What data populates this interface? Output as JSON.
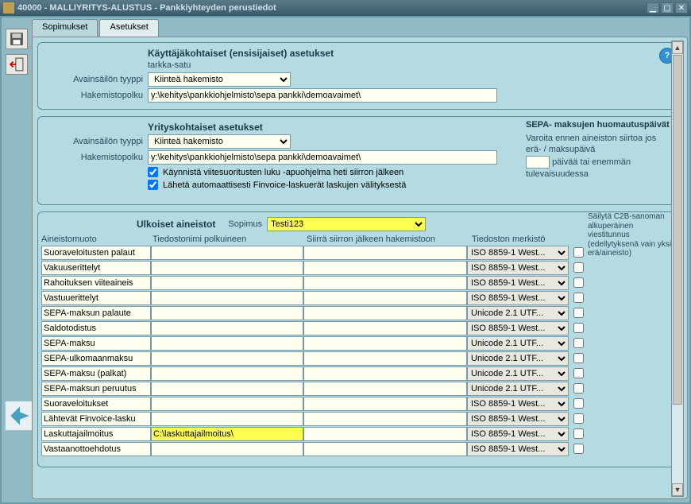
{
  "window": {
    "title": "40000 - MALLIYRITYS-ALUSTUS - Pankkiyhteyden perustiedot"
  },
  "tabs": {
    "t1": "Sopimukset",
    "t2": "Asetukset"
  },
  "panel1": {
    "title": "Käyttäjäkohtaiset (ensisijaiset) asetukset",
    "user": "tarkka-satu",
    "label_type": "Avainsäilön tyyppi",
    "type_value": "Kiinteä hakemisto",
    "label_path": "Hakemistopolku",
    "path_value": "y:\\kehitys\\pankkiohjelmisto\\sepa pankki\\demoavaimet\\"
  },
  "panel2": {
    "title": "Yrityskohtaiset asetukset",
    "label_type": "Avainsäilön tyyppi",
    "type_value": "Kiinteä hakemisto",
    "label_path": "Hakemistopolku",
    "path_value": "y:\\kehitys\\pankkiohjelmisto\\sepa pankki\\demoavaimet\\",
    "cb1": "Käynnistä viitesuoritusten luku -apuohjelma heti siirron jälkeen",
    "cb2": "Lähetä automaattisesti Finvoice-laskuerät laskujen välityksestä",
    "sepa_title": "SEPA- maksujen huomautuspäivät",
    "sepa_text1": "Varoita ennen aineiston siirtoa jos erä- / maksupäivä",
    "sepa_text2": "päivää tai enemmän tulevaisuudessa"
  },
  "panel3": {
    "title": "Ulkoiset aineistot",
    "contract_label": "Sopimus",
    "contract_value": "Testi123",
    "retain": "Säilytä C2B-sanoman alkuperäinen viestitunnus (edellytyksenä vain yksi erä/aineisto)",
    "headers": {
      "h1": "Aineistomuoto",
      "h2": "Tiedostonimi polkuineen",
      "h3": "Siirrä siirron jälkeen hakemistoon",
      "h4": "Tiedoston merkistö"
    },
    "rows": [
      {
        "name": "Suoraveloitusten palaut",
        "file": "",
        "dir": "",
        "enc": "ISO 8859-1 West...",
        "hl": false
      },
      {
        "name": "Vakuuserittelyt",
        "file": "",
        "dir": "",
        "enc": "ISO 8859-1 West...",
        "hl": false
      },
      {
        "name": "Rahoituksen viiteaineis",
        "file": "",
        "dir": "",
        "enc": "ISO 8859-1 West...",
        "hl": false
      },
      {
        "name": "Vastuuerittelyt",
        "file": "",
        "dir": "",
        "enc": "ISO 8859-1 West...",
        "hl": false
      },
      {
        "name": "SEPA-maksun palaute",
        "file": "",
        "dir": "",
        "enc": "Unicode 2.1 UTF...",
        "hl": false
      },
      {
        "name": "Saldotodistus",
        "file": "",
        "dir": "",
        "enc": "ISO 8859-1 West...",
        "hl": false
      },
      {
        "name": "SEPA-maksu",
        "file": "",
        "dir": "",
        "enc": "Unicode 2.1 UTF...",
        "hl": false
      },
      {
        "name": "SEPA-ulkomaanmaksu",
        "file": "",
        "dir": "",
        "enc": "Unicode 2.1 UTF...",
        "hl": false
      },
      {
        "name": "SEPA-maksu (palkat)",
        "file": "",
        "dir": "",
        "enc": "Unicode 2.1 UTF...",
        "hl": false
      },
      {
        "name": "SEPA-maksun peruutus",
        "file": "",
        "dir": "",
        "enc": "Unicode 2.1 UTF...",
        "hl": false
      },
      {
        "name": "Suoraveloitukset",
        "file": "",
        "dir": "",
        "enc": "ISO 8859-1 West...",
        "hl": false
      },
      {
        "name": "Lähtevät Finvoice-lasku",
        "file": "",
        "dir": "",
        "enc": "ISO 8859-1 West...",
        "hl": false
      },
      {
        "name": "Laskuttajailmoitus",
        "file": "C:\\laskuttajailmoitus\\",
        "dir": "",
        "enc": "ISO 8859-1 West...",
        "hl": true
      },
      {
        "name": "Vastaanottoehdotus",
        "file": "",
        "dir": "",
        "enc": "ISO 8859-1 West...",
        "hl": false
      }
    ]
  }
}
